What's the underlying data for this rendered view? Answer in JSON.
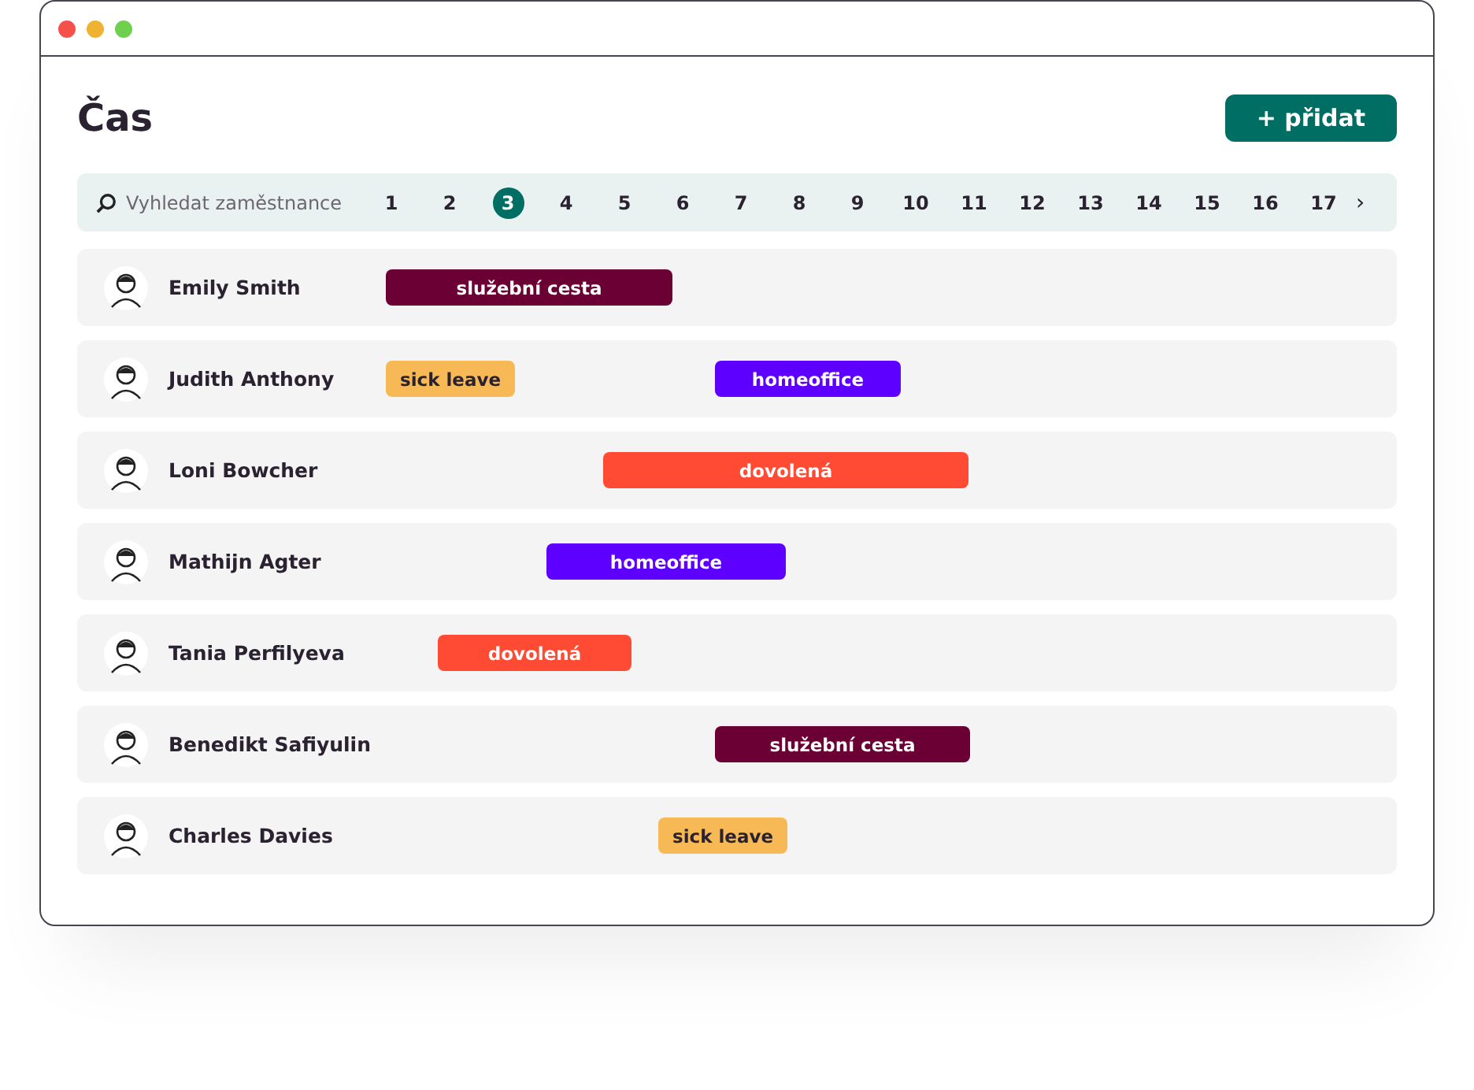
{
  "window": {
    "controls": [
      {
        "color": "#f5504a"
      },
      {
        "color": "#f0b232"
      },
      {
        "color": "#6fcf4f"
      }
    ]
  },
  "title": "Čas",
  "add_button": {
    "label": "+ přidat"
  },
  "search": {
    "placeholder": "Vyhledat zaměstnance"
  },
  "days": [
    {
      "label": "1",
      "selected": false
    },
    {
      "label": "2",
      "selected": false
    },
    {
      "label": "3",
      "selected": true
    },
    {
      "label": "4",
      "selected": false
    },
    {
      "label": "5",
      "selected": false
    },
    {
      "label": "6",
      "selected": false
    },
    {
      "label": "7",
      "selected": false
    },
    {
      "label": "8",
      "selected": false
    },
    {
      "label": "9",
      "selected": false
    },
    {
      "label": "10",
      "selected": false
    },
    {
      "label": "11",
      "selected": false
    },
    {
      "label": "12",
      "selected": false
    },
    {
      "label": "13",
      "selected": false
    },
    {
      "label": "14",
      "selected": false
    },
    {
      "label": "15",
      "selected": false
    },
    {
      "label": "16",
      "selected": false
    },
    {
      "label": "17",
      "selected": false
    }
  ],
  "next_arrow": "›",
  "employees": [
    {
      "name": "Emily Smith",
      "events": [
        {
          "label": "služební cesta",
          "color": "#6b0035"
        }
      ]
    },
    {
      "name": "Judith Anthony",
      "events": [
        {
          "label": "sick leave",
          "color": "#f7b955"
        },
        {
          "label": "homeoffice",
          "color": "#5d00ff"
        }
      ]
    },
    {
      "name": "Loni Bowcher",
      "events": [
        {
          "label": "dovolená",
          "color": "#ff4b33"
        }
      ]
    },
    {
      "name": "Mathijn Agter",
      "events": [
        {
          "label": "homeoffice",
          "color": "#5d00ff"
        }
      ]
    },
    {
      "name": "Tania Perfilyeva",
      "events": [
        {
          "label": "dovolená",
          "color": "#ff4b33"
        }
      ]
    },
    {
      "name": "Benedikt Safiyulin",
      "events": [
        {
          "label": "služební cesta",
          "color": "#6b0035"
        }
      ]
    },
    {
      "name": "Charles Davies",
      "events": [
        {
          "label": "sick leave",
          "color": "#f7b955"
        }
      ]
    }
  ]
}
